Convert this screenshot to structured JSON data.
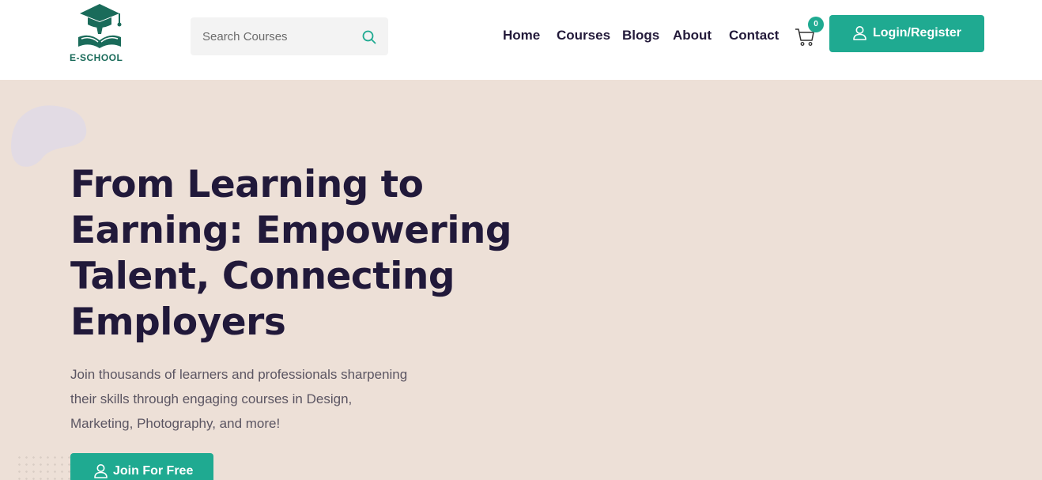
{
  "header": {
    "logo_text": "E-SCHOOL",
    "search": {
      "placeholder": "Search Courses"
    },
    "nav": [
      {
        "label": "Home"
      },
      {
        "label": "Courses"
      },
      {
        "label": "Blogs"
      },
      {
        "label": "About"
      },
      {
        "label": "Contact"
      }
    ],
    "cart": {
      "count": "0",
      "icon": "cart-icon"
    },
    "login_button": {
      "label": "Login/Register",
      "icon": "user-icon"
    }
  },
  "hero": {
    "title_lines": [
      "From Learning to",
      "Earning: Empowering",
      "Talent, Connecting",
      "Employers"
    ],
    "description_lines": [
      "Join thousands of learners and professionals sharpening",
      "their skills through engaging courses in Design,",
      "Marketing, Photography, and more!"
    ],
    "cta_button": {
      "label": "Join For Free",
      "icon": "user-icon"
    }
  },
  "colors": {
    "accent": "#1faa91",
    "brand_dark": "#1a6b5a",
    "heading": "#21193a",
    "hero_background": "#ede0d7",
    "blob": "#e2dbe4"
  }
}
